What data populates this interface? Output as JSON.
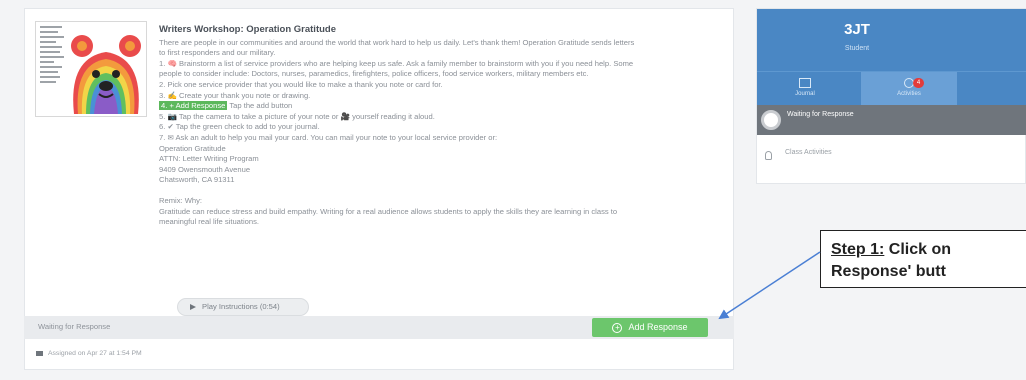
{
  "activity": {
    "title": "Writers Workshop: Operation Gratitude",
    "intro_1": "There are people in our communities and around the world that work hard to help us daily. Let's thank them! Operation Gratitude sends letters",
    "intro_2": "to first responders and our military.",
    "step_1a": "1. 🧠 Brainstorm a list of service providers who are helping keep us safe. Ask a family member to brainstorm with you if you need help. Some",
    "step_1b": "people to consider include: Doctors, nurses, paramedics, firefighters, police officers, food service workers, military members etc.",
    "step_2": "2. Pick one service provider that you would like to make a thank you note or card for.",
    "step_3": "3. ✍ Create your thank you note or drawing.",
    "step_4_highlight": "4. + Add Response",
    "step_4_rest": " Tap the add button",
    "step_5": "5. 📷 Tap the camera to take a picture of your note or 🎥 yourself reading it aloud.",
    "step_6": "6. ✔ Tap the green check to add to your journal.",
    "step_7": "7. ✉ Ask an adult to help you mail your card. You can mail your note to your local service provider or:",
    "addr_1": "Operation Gratitude",
    "addr_2": "ATTN: Letter Writing Program",
    "addr_3": "9409 Owensmouth Avenue",
    "addr_4": "Chatsworth, CA 91311",
    "remix_title": "Remix: Why:",
    "remix_1": "Gratitude can reduce stress and build empathy. Writing for a real audience allows students to apply the skills they are learning in class to",
    "remix_2": "meaningful real life situations.",
    "play_label": "Play Instructions (0:54)"
  },
  "response_bar": {
    "status": "Waiting for Response",
    "add_button": "Add Response"
  },
  "footer": {
    "assigned": "Assigned on Apr 27 at 1:54 PM"
  },
  "student": {
    "name": "3JT",
    "role": "Student",
    "tabs": [
      {
        "label": "Journal"
      },
      {
        "label": "Activities",
        "badge": "4"
      }
    ],
    "waiting_label": "Waiting for Response",
    "class_label": "Class Activities"
  },
  "callout": {
    "step_label": "Step 1:",
    "line_1_rest": " Click on",
    "line_2": "Response' butt"
  },
  "colors": {
    "accent_blue": "#4a87c4",
    "add_green": "#6cc66c",
    "badge_red": "#e23b3b"
  }
}
